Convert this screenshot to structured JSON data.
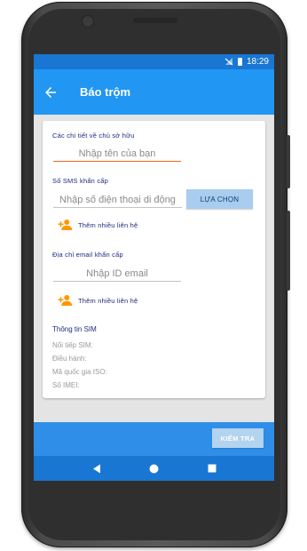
{
  "status_bar": {
    "time": "18:29"
  },
  "app_bar": {
    "title": "Báo trộm"
  },
  "owner": {
    "label": "Các chi tiết về chủ sở hữu",
    "name_placeholder": "Nhập tên của bạn"
  },
  "sms": {
    "label": "Số SMS khẩn cấp",
    "phone_placeholder": "Nhập số điện thoại di động",
    "pick_label": "LỰA CHỌN",
    "add_label": "Thêm nhiều liên hệ"
  },
  "email": {
    "label": "Địa chỉ email khẩn cấp",
    "email_placeholder": "Nhập ID email",
    "add_label": "Thêm nhiều liên hệ"
  },
  "sim": {
    "heading": "Thông tin SIM",
    "serial": "Nối tiếp SIM:",
    "operator": "Điều hành:",
    "country_code": "Mã quốc gia ISO:",
    "imei": "Số IMEI:"
  },
  "footer": {
    "check_label": "KIỂM TRA"
  },
  "colors": {
    "status_bar": "#1976d2",
    "app_bar": "#2196f3",
    "accent_orange": "#f26522",
    "label_navy": "#1c2a7a",
    "contact_icon": "#ff9800"
  },
  "icons": [
    "back-arrow-icon",
    "signal-off-icon",
    "battery-icon",
    "add-contact-icon",
    "nav-back-icon",
    "nav-home-icon",
    "nav-recents-icon"
  ]
}
